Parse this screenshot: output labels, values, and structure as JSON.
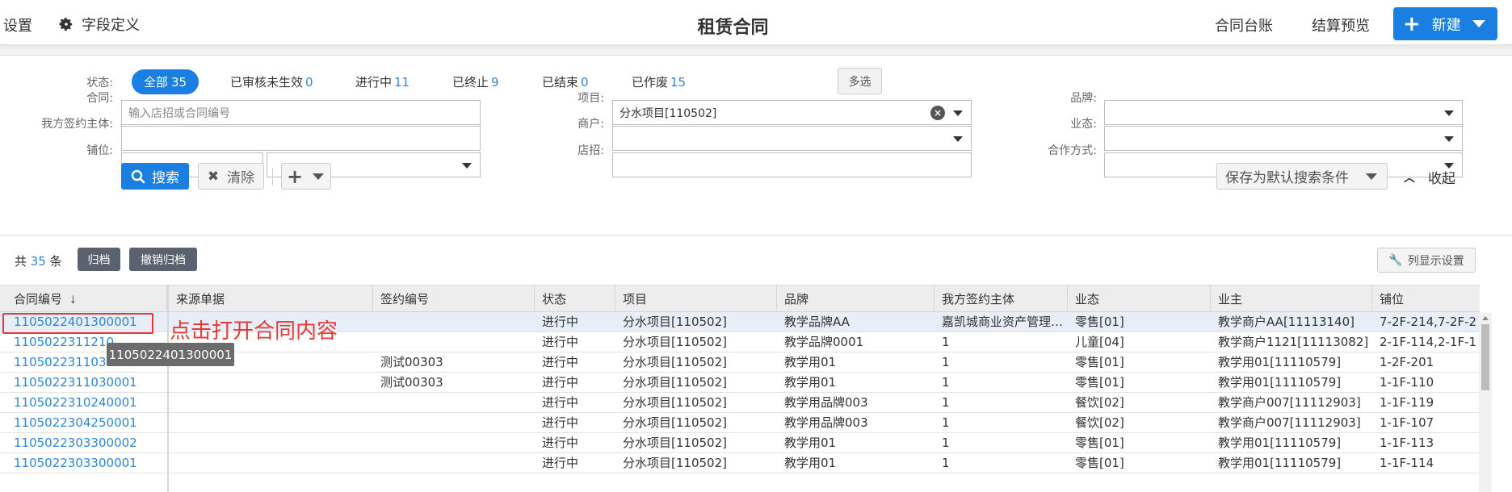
{
  "topbar": {
    "settings": "设置",
    "fields": "字段定义",
    "title": "租赁合同",
    "ledger": "合同台账",
    "settle_preview": "结算预览",
    "new_label": "新建",
    "icons": {
      "fields": "gear-icon",
      "new": "plus-icon",
      "new_menu": "caret-down-icon"
    }
  },
  "filter": {
    "status_label": "状态:",
    "statuses": [
      {
        "label": "全部",
        "count": "35"
      },
      {
        "label": "已审核未生效",
        "count": "0"
      },
      {
        "label": "进行中",
        "count": "11"
      },
      {
        "label": "已终止",
        "count": "9"
      },
      {
        "label": "已结束",
        "count": "0"
      },
      {
        "label": "已作废",
        "count": "15"
      }
    ],
    "multi_select": "多选",
    "contract_label": "合同:",
    "contract_placeholder": "输入店招或合同编号",
    "entity_label": "我方签约主体:",
    "entity_value": "",
    "shop_label": "铺位:",
    "project_label": "项目:",
    "project_value": "分水项目[110502]",
    "merchant_label": "商户:",
    "signboard_label": "店招:",
    "brand_label": "品牌:",
    "format_label": "业态:",
    "coop_label": "合作方式:",
    "search_btn": "搜索",
    "clear_btn": "清除",
    "save_default": "保存为默认搜索条件",
    "collapse": "收起"
  },
  "list": {
    "total_prefix": "共",
    "total_count": "35",
    "total_suffix": "条",
    "archive_btn": "归档",
    "unarchive_btn": "撤销归档",
    "col_settings_btn": "列显示设置",
    "columns": [
      "合同编号",
      "来源单据",
      "签约编号",
      "状态",
      "项目",
      "品牌",
      "我方签约主体",
      "业态",
      "业主",
      "铺位"
    ],
    "rows": [
      [
        "1105022401300001",
        "",
        "",
        "进行中",
        "分水项目[110502]",
        "教学品牌AA",
        "嘉凯城商业资产管理…",
        "零售[01]",
        "教学商户AA[11113140]",
        "7-2F-214,7-2F-2"
      ],
      [
        "1105022311210",
        "",
        "",
        "进行中",
        "分水项目[110502]",
        "教学品牌0001",
        "1",
        "儿童[04]",
        "教学商户1121[11113082]",
        "2-1F-114,2-1F-1"
      ],
      [
        "1105022311030002",
        "",
        "测试00303",
        "进行中",
        "分水项目[110502]",
        "教学用01",
        "1",
        "零售[01]",
        "教学用01[11110579]",
        "1-2F-201"
      ],
      [
        "1105022311030001",
        "",
        "测试00303",
        "进行中",
        "分水项目[110502]",
        "教学用01",
        "1",
        "零售[01]",
        "教学用01[11110579]",
        "1-1F-110"
      ],
      [
        "1105022310240001",
        "",
        "",
        "进行中",
        "分水项目[110502]",
        "教学用品牌003",
        "1",
        "餐饮[02]",
        "教学商户007[11112903]",
        "1-1F-119"
      ],
      [
        "1105022304250001",
        "",
        "",
        "进行中",
        "分水项目[110502]",
        "教学用品牌003",
        "1",
        "餐饮[02]",
        "教学商户007[11112903]",
        "1-1F-107"
      ],
      [
        "1105022303300002",
        "",
        "",
        "进行中",
        "分水项目[110502]",
        "教学用01",
        "1",
        "零售[01]",
        "教学用01[11110579]",
        "1-1F-113"
      ],
      [
        "1105022303300001",
        "",
        "",
        "进行中",
        "分水项目[110502]",
        "教学用01",
        "1",
        "零售[01]",
        "教学用01[11110579]",
        "1-1F-114"
      ]
    ]
  },
  "annotation": {
    "text": "点击打开合同内容",
    "tooltip": "1105022401300001",
    "color": "#e53935"
  },
  "colors": {
    "accent": "#1a7fe0",
    "link": "#2f86d6",
    "selected_row": "#e7eef7"
  }
}
